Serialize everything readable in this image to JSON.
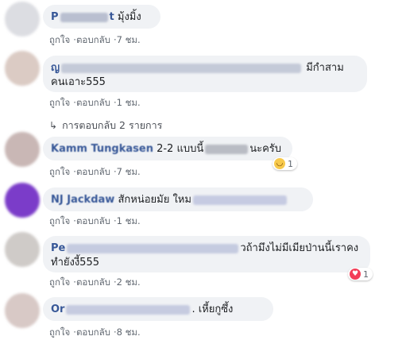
{
  "comments": [
    {
      "author": "P",
      "author_tail": "t",
      "text": "มุ้งมิ้ง",
      "like": "ถูกใจ",
      "reply": "ตอบกลับ",
      "time": "7 ชม.",
      "avatar_color": "#dcdde2"
    },
    {
      "author": "ญ",
      "text_line1": "มีกำสาม",
      "text_line2": "คนเอาะ555",
      "like": "ถูกใจ",
      "reply": "ตอบกลับ",
      "time": "1 ชม.",
      "avatar_color": "#dbcbc4",
      "replies_label": "การตอบกลับ 2 รายการ"
    },
    {
      "author": "Kamm Tungkasen",
      "text_pre": "2-2 แบบนี้",
      "text_post": "นะครับ",
      "like": "ถูกใจ",
      "reply": "ตอบกลับ",
      "time": "7 ชม.",
      "avatar_color": "#c9b7b5",
      "reaction_count": "1"
    },
    {
      "author": "NJ Jackdaw",
      "text": "สักหน่อยมัย ใหม",
      "like": "ถูกใจ",
      "reply": "ตอบกลับ",
      "time": "1 ชม.",
      "avatar_color": "#7b3cc9"
    },
    {
      "author": "Pe",
      "text_line1": "วถ้ามึงไม่มีเมียป่านนี้เราคง",
      "text_line2": "ทำยังงี้555",
      "like": "ถูกใจ",
      "reply": "ตอบกลับ",
      "time": "2 ชม.",
      "avatar_color": "#cfcbc8",
      "reaction_count": "1"
    },
    {
      "author": "Or",
      "text": ". เหี้ยกูซึ้ง",
      "like": "ถูกใจ",
      "reply": "ตอบกลับ",
      "time": "8 ชม.",
      "avatar_color": "#d8c9c6"
    }
  ]
}
